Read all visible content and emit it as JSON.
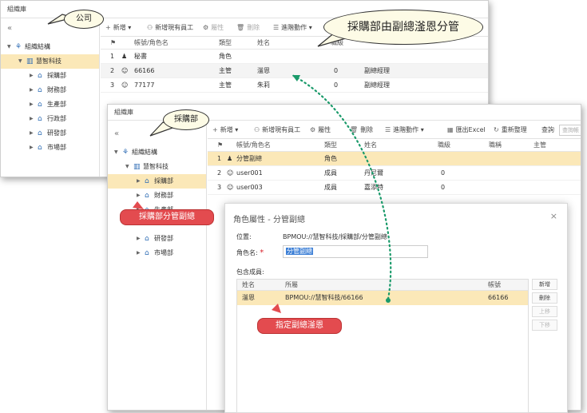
{
  "win1": {
    "title": "組織庫",
    "collapse": "«",
    "tree": [
      {
        "label": "組織結構",
        "icon": "org-icon",
        "level": 0
      },
      {
        "label": "慧智科技",
        "icon": "building-icon",
        "level": 1,
        "selected": true
      },
      {
        "label": "採購部",
        "icon": "home-icon",
        "level": 2
      },
      {
        "label": "財務部",
        "icon": "home-icon",
        "level": 2
      },
      {
        "label": "生產部",
        "icon": "home-icon",
        "level": 2
      },
      {
        "label": "行政部",
        "icon": "home-icon",
        "level": 2
      },
      {
        "label": "研發部",
        "icon": "home-icon",
        "level": 2
      },
      {
        "label": "市場部",
        "icon": "home-icon",
        "level": 2
      }
    ],
    "toolbar": {
      "add": "新增",
      "add_staff": "新增現有員工",
      "props": "屬性",
      "delete": "刪除",
      "advanced": "進階動作"
    },
    "columns": {
      "account": "帳號/角色名",
      "type": "類型",
      "name": "姓名",
      "level": "職級"
    },
    "rows": [
      {
        "no": "1",
        "account": "秘書",
        "type": "角色",
        "name": "",
        "level": "",
        "title": ""
      },
      {
        "no": "2",
        "account": "66166",
        "type": "主管",
        "name": "滏恩",
        "level": "0",
        "title": "副總經理"
      },
      {
        "no": "3",
        "account": "77177",
        "type": "主管",
        "name": "朱莉",
        "level": "0",
        "title": "副總經理"
      }
    ]
  },
  "win2": {
    "title": "組織庫",
    "collapse": "«",
    "tree": [
      {
        "label": "組織結構",
        "icon": "org-icon",
        "level": 0
      },
      {
        "label": "慧智科技",
        "icon": "building-icon",
        "level": 1
      },
      {
        "label": "採購部",
        "icon": "home-icon",
        "level": 2,
        "selected": true
      },
      {
        "label": "財務部",
        "icon": "home-icon",
        "level": 2
      },
      {
        "label": "生產部",
        "icon": "home-icon",
        "level": 2
      },
      {
        "label": "",
        "icon": "",
        "level": 2
      },
      {
        "label": "研發部",
        "icon": "home-icon",
        "level": 2
      },
      {
        "label": "市場部",
        "icon": "home-icon",
        "level": 2
      }
    ],
    "toolbar": {
      "add": "新增",
      "add_staff": "新增現有員工",
      "props": "屬性",
      "delete": "刪除",
      "advanced": "進階動作",
      "export": "匯出Excel",
      "reorder": "重新整理",
      "search": "查詢",
      "search_placeholder": "查詢帳"
    },
    "columns": {
      "account": "帳號/角色名",
      "type": "類型",
      "name": "姓名",
      "level": "職級",
      "title": "職稱",
      "manager": "主管"
    },
    "rows": [
      {
        "no": "1",
        "account": "分管副總",
        "type": "角色",
        "name": "",
        "level": ""
      },
      {
        "no": "2",
        "account": "user001",
        "type": "成員",
        "name": "丹尼爾",
        "level": "0"
      },
      {
        "no": "3",
        "account": "user003",
        "type": "成員",
        "name": "嘉添特",
        "level": "0"
      }
    ]
  },
  "dialog": {
    "title": "角色屬性 - 分管副總",
    "close": "×",
    "location_label": "位置:",
    "location_value": "BPMOU://慧智科技/採購部/分管副總",
    "name_label": "角色名:",
    "required": "*",
    "name_value": "分管副總",
    "members_label": "包含成員:",
    "mcols": {
      "name": "姓名",
      "belongs": "所屬",
      "account": "帳號"
    },
    "member": {
      "name": "滏恩",
      "belongs": "BPMOU://慧智科技/66166",
      "account": "66166"
    },
    "buttons": {
      "add": "新增",
      "delete": "刪除",
      "up": "上移",
      "down": "下移"
    }
  },
  "callouts": {
    "company": "公司",
    "purchasing": "採購部",
    "headline": "採購部由副總滏恩分管",
    "vp_role": "採購部分管副總",
    "assign": "指定副總滏恩"
  },
  "colors": {
    "selected_row": "#fbe8b8",
    "callout_red": "#e34b4f",
    "dotted_arrow": "#1a9a6a",
    "bubble_fill": "#fdfbe6"
  }
}
